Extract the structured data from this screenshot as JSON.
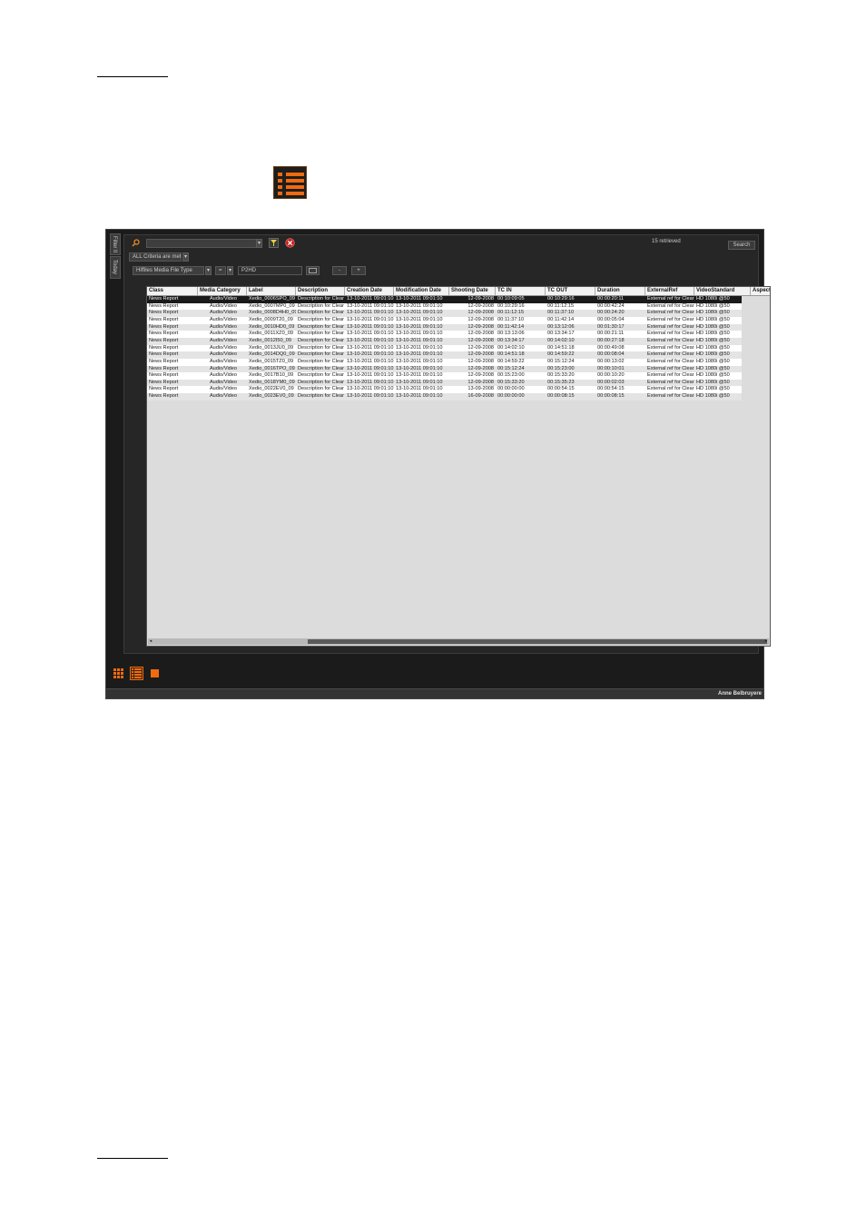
{
  "app": {
    "side_tabs": [
      "Filter Il",
      "Today"
    ],
    "search_placeholder": "",
    "criteria_label": "ALL Criteria are met",
    "retrieved": "15 retrieved",
    "search_button": "Search",
    "filter_field": "Hiffiles Media File Type",
    "filter_operator": "=",
    "filter_value": "P2HD",
    "minus_label": "-",
    "plus_label": "+",
    "user_name": "Anne Belbruyere"
  },
  "grid": {
    "columns": [
      "Class",
      "Media Category",
      "Label",
      "Description",
      "Creation Date",
      "Modification Date",
      "Shooting Date",
      "TC IN",
      "TC OUT",
      "Duration",
      "ExternalRef",
      "VideoStandard",
      "Aspect"
    ],
    "rows": [
      [
        "News Report",
        "Audio/Video",
        "Xedio_0006SPO_09",
        "Description for Clear",
        "13-10-2011 09:01:10",
        "13-10-2011 09:01:10",
        "12-09-2008",
        "00:10:09:05",
        "00:10:29:16",
        "00:00:20:11",
        "External ref for Clear",
        "HD 1080i @50",
        ""
      ],
      [
        "News Report",
        "Audio/Video",
        "Xedio_0007MP0_09",
        "Description for Clear",
        "13-10-2011 09:01:10",
        "13-10-2011 09:01:10",
        "12-09-2008",
        "00:10:29:16",
        "00:11:12:15",
        "00:00:42:24",
        "External ref for Clear",
        "HD 1080i @50",
        ""
      ],
      [
        "News Report",
        "Audio/Video",
        "Xedio_0008D4H0_09",
        "Description for Clear",
        "13-10-2011 09:01:10",
        "13-10-2011 09:01:10",
        "12-09-2008",
        "00:11:12:15",
        "00:11:37:10",
        "00:00:24:20",
        "External ref for Clear",
        "HD 1080i @50",
        ""
      ],
      [
        "News Report",
        "Audio/Video",
        "Xedio_0009T20_09",
        "Description for Clear",
        "13-10-2011 09:01:10",
        "13-10-2011 09:01:10",
        "12-09-2008",
        "00:11:37:10",
        "00:11:42:14",
        "00:00:05:04",
        "External ref for Clear",
        "HD 1080i @50",
        ""
      ],
      [
        "News Report",
        "Audio/Video",
        "Xedio_0010HD0_09",
        "Description for Clear",
        "13-10-2011 09:01:10",
        "13-10-2011 09:01:10",
        "12-09-2008",
        "00:11:42:14",
        "00:13:12:06",
        "00:01:30:17",
        "External ref for Clear",
        "HD 1080i @50",
        ""
      ],
      [
        "News Report",
        "Audio/Video",
        "Xedio_0011XZ0_09",
        "Description for Clear",
        "13-10-2011 09:01:10",
        "13-10-2011 09:01:10",
        "12-09-2008",
        "00:13:13:06",
        "00:13:34:17",
        "00:00:21:11",
        "External ref for Clear",
        "HD 1080i @50",
        ""
      ],
      [
        "News Report",
        "Audio/Video",
        "Xedio_0012I50_09",
        "Description for Clear",
        "13-10-2011 09:01:10",
        "13-10-2011 09:01:10",
        "12-09-2008",
        "00:13:34:17",
        "00:14:02:10",
        "00:00:27:18",
        "External ref for Clear",
        "HD 1080i @50",
        ""
      ],
      [
        "News Report",
        "Audio/Video",
        "Xedio_0013JU0_09",
        "Description for Clear",
        "13-10-2011 09:01:10",
        "13-10-2011 09:01:10",
        "12-09-2008",
        "00:14:02:10",
        "00:14:51:18",
        "00:00:49:08",
        "External ref for Clear",
        "HD 1080i @50",
        ""
      ],
      [
        "News Report",
        "Audio/Video",
        "Xedio_0014DQ0_09",
        "Description for Clear",
        "13-10-2011 09:01:10",
        "13-10-2011 09:01:10",
        "12-09-2008",
        "00:14:51:18",
        "00:14:59:22",
        "00:00:08:04",
        "External ref for Clear",
        "HD 1080i @50",
        ""
      ],
      [
        "News Report",
        "Audio/Video",
        "Xedio_0015TZ0_09",
        "Description for Clear",
        "13-10-2011 09:01:10",
        "13-10-2011 09:01:10",
        "12-09-2008",
        "00:14:59:22",
        "00:15:12:24",
        "00:00:13:02",
        "External ref for Clear",
        "HD 1080i @50",
        ""
      ],
      [
        "News Report",
        "Audio/Video",
        "Xedio_0016TPO_09",
        "Description for Clear",
        "13-10-2011 09:01:10",
        "13-10-2011 09:01:10",
        "12-09-2008",
        "00:15:12:24",
        "00:15:23:00",
        "00:00:10:01",
        "External ref for Clear",
        "HD 1080i @50",
        ""
      ],
      [
        "News Report",
        "Audio/Video",
        "Xedio_0017B10_09",
        "Description for Clear",
        "13-10-2011 09:01:10",
        "13-10-2011 09:01:10",
        "12-09-2008",
        "00:15:23:00",
        "00:15:33:20",
        "00:00:10:20",
        "External ref for Clear",
        "HD 1080i @50",
        ""
      ],
      [
        "News Report",
        "Audio/Video",
        "Xedio_0018YM0_09",
        "Description for Clear",
        "13-10-2011 09:01:10",
        "13-10-2011 09:01:10",
        "12-09-2008",
        "00:15:33:20",
        "00:15:35:23",
        "00:00:02:03",
        "External ref for Clear",
        "HD 1080i @50",
        ""
      ],
      [
        "News Report",
        "Audio/Video",
        "Xedio_0022EV0_09",
        "Description for Clear",
        "13-10-2011 09:01:10",
        "13-10-2011 09:01:10",
        "13-09-2008",
        "00:00:00:00",
        "00:00:54:15",
        "00:00:54:15",
        "External ref for Clear",
        "HD 1080i @50",
        ""
      ],
      [
        "News Report",
        "Audio/Video",
        "Xedio_0023EV0_09",
        "Description for Clear",
        "13-10-2011 09:01:10",
        "13-10-2011 09:01:10",
        "16-09-2008",
        "00:00:00:00",
        "00:00:08:15",
        "00:00:08:15",
        "External ref for Clear",
        "HD 1080i @50",
        ""
      ]
    ]
  },
  "view_buttons": [
    {
      "icon": "grid-view-icon",
      "active": false
    },
    {
      "icon": "list-view-icon",
      "active": true
    },
    {
      "icon": "single-view-icon",
      "active": false
    }
  ],
  "colors": {
    "accent": "#f06a0e",
    "panel": "#262626",
    "grid_bg": "#dcdcdc"
  }
}
